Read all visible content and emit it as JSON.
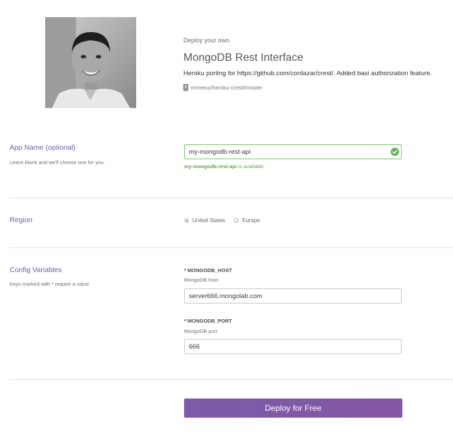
{
  "header": {
    "eyebrow": "Deploy your own",
    "title": "MongoDB Rest Interface",
    "description": "Heroku porting for https://github.com/cordazar/crest/. Added basi authorization feature.",
    "repo": "enreeco/heroku-crest#master",
    "avatar_icon": "user-photo"
  },
  "app_name": {
    "label": "App Name (optional)",
    "hint": "Leave blank and we'll choose one for you.",
    "value": "my-mongodb-rest-api",
    "availability_name": "my-mongodb-rest-api",
    "availability_suffix": " is available",
    "status_icon": "check-circle-icon",
    "accent_color": "#5fa652"
  },
  "region": {
    "label": "Region",
    "options": [
      {
        "label": "United States",
        "selected": true
      },
      {
        "label": "Europe",
        "selected": false
      }
    ]
  },
  "config": {
    "label": "Config Variables",
    "hint": "Keys marked with * require a value.",
    "vars": [
      {
        "name": "* MONGODB_HOST",
        "description": "MongoDB host",
        "value": "server666.mongolab.com"
      },
      {
        "name": "* MONGODB_PORT",
        "description": "MongoDB port",
        "value": "666"
      }
    ]
  },
  "actions": {
    "deploy_label": "Deploy for Free",
    "button_color": "#7b5ba9"
  }
}
